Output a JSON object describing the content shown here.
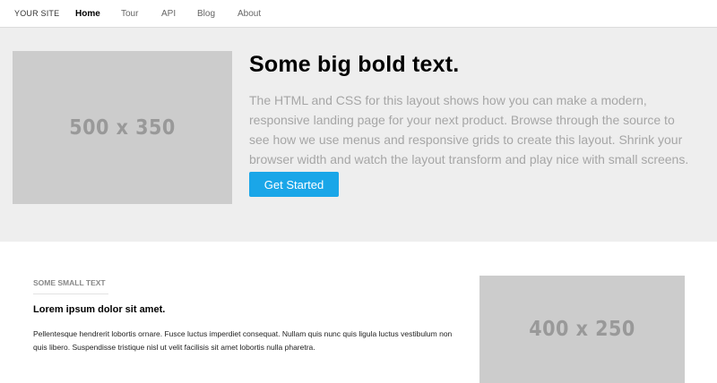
{
  "nav": {
    "brand": "YOUR SITE",
    "items": [
      {
        "label": "Home",
        "active": true
      },
      {
        "label": "Tour",
        "active": false
      },
      {
        "label": "API",
        "active": false
      },
      {
        "label": "Blog",
        "active": false
      },
      {
        "label": "About",
        "active": false
      }
    ]
  },
  "hero": {
    "image_label": "500 x 350",
    "title": "Some big bold text.",
    "text": "The HTML and CSS for this layout shows how you can make a modern, responsive landing page for your next product. Browse through the source to see how we use menus and responsive grids to create this layout. Shrink your browser width and watch the layout transform and play nice with small screens.",
    "cta_label": "Get Started"
  },
  "content": {
    "eyebrow": "SOME SMALL TEXT",
    "heading": "Lorem ipsum dolor sit amet.",
    "body": "Pellentesque hendrerit lobortis ornare. Fusce luctus imperdiet consequat. Nullam quis nunc quis ligula luctus vestibulum non quis libero. Suspendisse tristique nisl ut velit facilisis sit amet lobortis nulla pharetra.",
    "image_label": "400 x 250"
  },
  "colors": {
    "accent": "#1aa6e8",
    "hero_bg": "#eeeeee",
    "placeholder_bg": "#cccccc"
  }
}
